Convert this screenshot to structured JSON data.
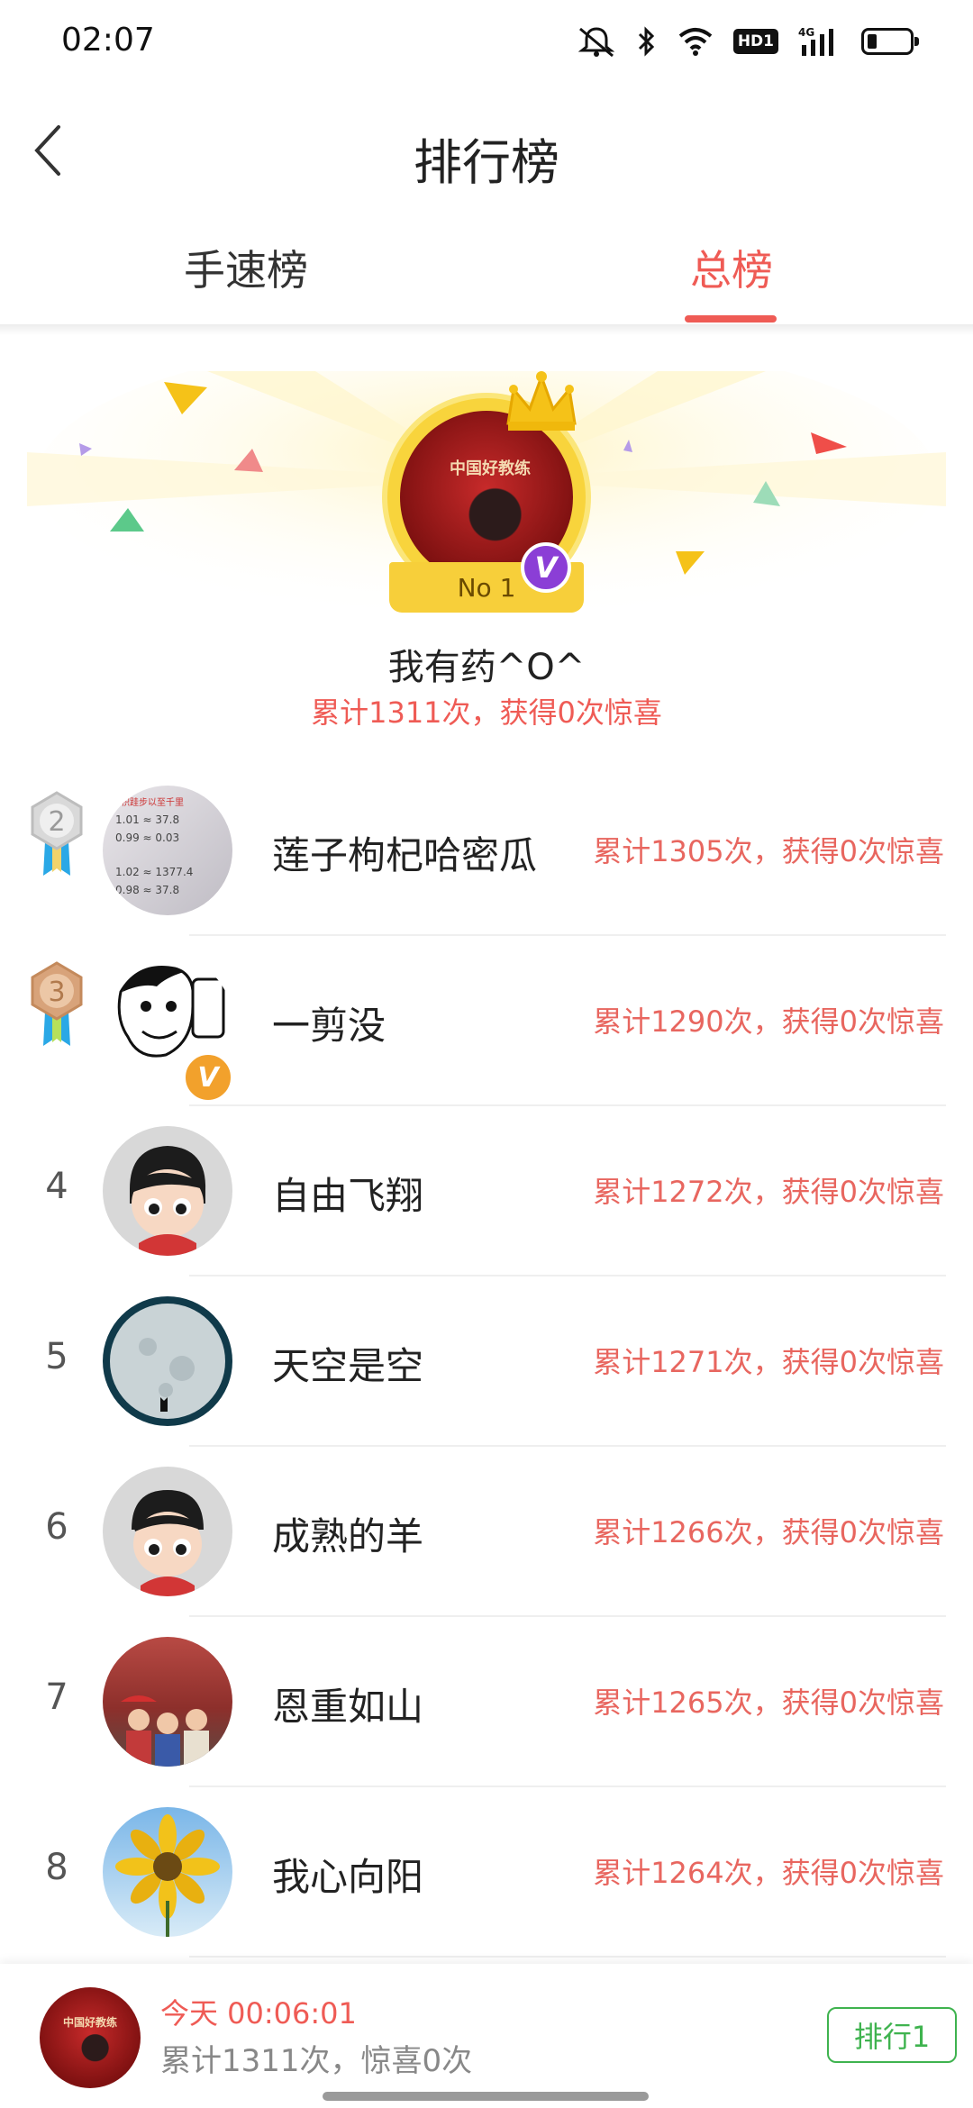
{
  "status_bar": {
    "time": "02:07",
    "network": "4G",
    "hd": "HD1"
  },
  "header": {
    "title": "排行榜"
  },
  "tabs": [
    {
      "label": "手速榜",
      "active": false
    },
    {
      "label": "总榜",
      "active": true
    }
  ],
  "champion": {
    "badge": "No 1",
    "vip": "V",
    "avatar_banner": "中国好教练",
    "name": "我有药^O^",
    "stats": "累计1311次，获得0次惊喜"
  },
  "ranks": [
    {
      "rank": "2",
      "name": "莲子枸杞哈密瓜",
      "stats": "累计1305次，获得0次惊喜"
    },
    {
      "rank": "3",
      "name": "一剪没",
      "stats": "累计1290次，获得0次惊喜",
      "vip": "V"
    },
    {
      "rank": "4",
      "name": "自由飞翔",
      "stats": "累计1272次，获得0次惊喜"
    },
    {
      "rank": "5",
      "name": "天空是空",
      "stats": "累计1271次，获得0次惊喜"
    },
    {
      "rank": "6",
      "name": "成熟的羊",
      "stats": "累计1266次，获得0次惊喜"
    },
    {
      "rank": "7",
      "name": "恩重如山",
      "stats": "累计1265次，获得0次惊喜"
    },
    {
      "rank": "8",
      "name": "我心向阳",
      "stats": "累计1264次，获得0次惊喜"
    }
  ],
  "bottom_bar": {
    "today": "今天 00:06:01",
    "stats": "累计1311次，惊喜0次",
    "rank_button": "排行1"
  },
  "colors": {
    "accent": "#ef5b55",
    "green": "#3fb34f",
    "gold": "#f7cf3a"
  }
}
